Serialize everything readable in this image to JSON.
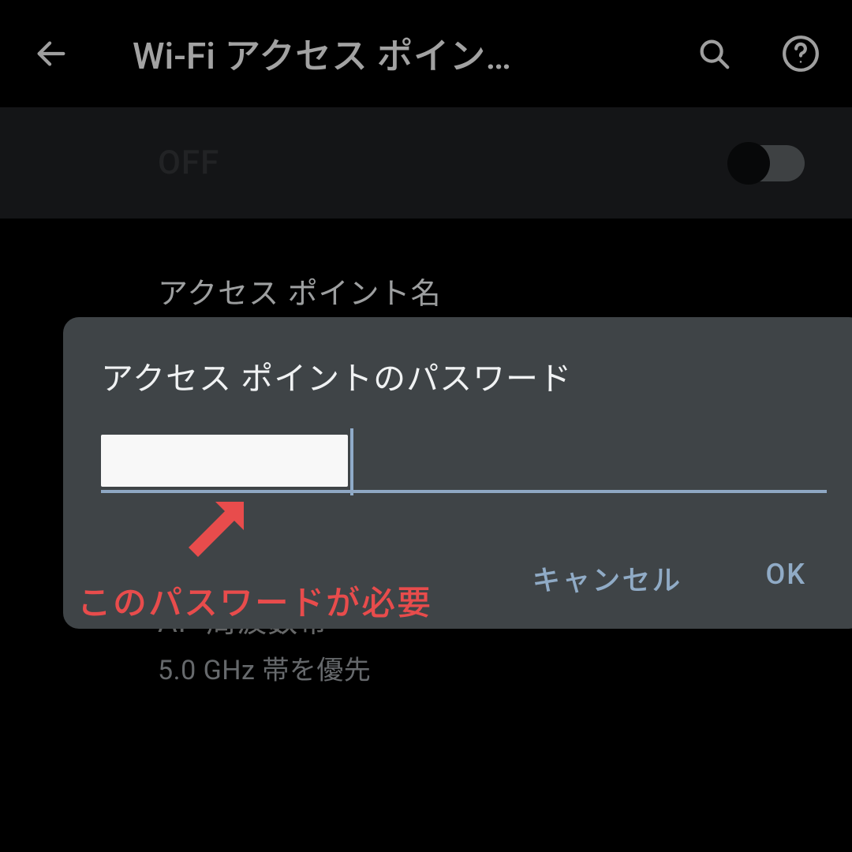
{
  "appbar": {
    "title": "Wi-Fi アクセス ポイン…"
  },
  "toggle": {
    "label": "OFF",
    "state": false
  },
  "items": {
    "ap_name": {
      "primary": "アクセス ポイント名"
    },
    "ap_band": {
      "primary": "AP 周波数帯",
      "secondary": "5.0 GHz 帯を優先"
    }
  },
  "password_dots": "••••••••••••",
  "dialog": {
    "title": "アクセス ポイントのパスワード",
    "cancel": "キャンセル",
    "ok": "OK"
  },
  "annotation": {
    "text": "このパスワードが必要",
    "color": "#e84c4c"
  }
}
